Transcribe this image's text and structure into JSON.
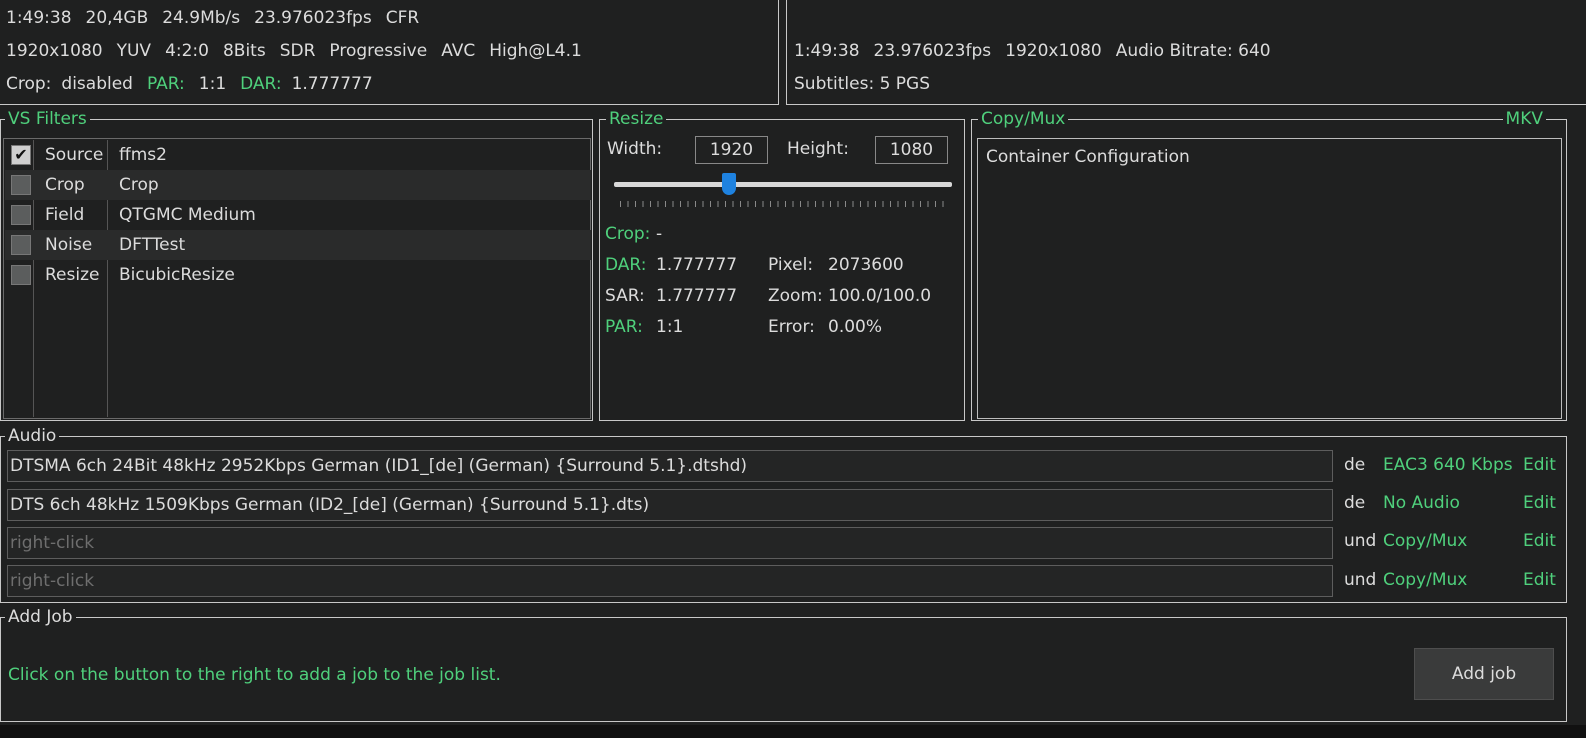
{
  "info_left": {
    "line1": [
      "1:49:38",
      "20,4GB",
      "24.9Mb/s",
      "23.976023fps",
      "CFR"
    ],
    "line2": [
      "1920x1080",
      "YUV",
      "4:2:0",
      "8Bits",
      "SDR",
      "Progressive",
      "AVC",
      "High@L4.1"
    ],
    "crop_label": "Crop:",
    "crop_value": "disabled",
    "par_label": "PAR:",
    "par_value": "1:1",
    "dar_label": "DAR:",
    "dar_value": "1.777777"
  },
  "info_right": {
    "line1": [
      "1:49:38",
      "23.976023fps",
      "1920x1080",
      "Audio Bitrate: 640"
    ],
    "line2": "Subtitles: 5 PGS"
  },
  "vs_filters": {
    "title": "VS Filters",
    "items": [
      {
        "checked": true,
        "name": "Source",
        "value": "ffms2"
      },
      {
        "checked": false,
        "name": "Crop",
        "value": "Crop"
      },
      {
        "checked": false,
        "name": "Field",
        "value": "QTGMC Medium"
      },
      {
        "checked": false,
        "name": "Noise",
        "value": "DFTTest"
      },
      {
        "checked": false,
        "name": "Resize",
        "value": "BicubicResize"
      }
    ],
    "check_glyph": "✔"
  },
  "resize": {
    "title": "Resize",
    "width_label": "Width:",
    "width_value": "1920",
    "height_label": "Height:",
    "height_value": "1080",
    "slider_fraction": 0.34,
    "crop_label": "Crop:",
    "crop_value": "-",
    "dar_label": "DAR:",
    "dar_value": "1.777777",
    "sar_label": "SAR:",
    "sar_value": "1.777777",
    "par_label": "PAR:",
    "par_value": "1:1",
    "pixel_label": "Pixel:",
    "pixel_value": "2073600",
    "zoom_label": "Zoom:",
    "zoom_value": "100.0/100.0",
    "error_label": "Error:",
    "error_value": "0.00%"
  },
  "container": {
    "title": "Copy/Mux",
    "format": "MKV",
    "text": "Container Configuration"
  },
  "audio": {
    "title": "Audio",
    "tracks": [
      {
        "file": "DTSMA 6ch 24Bit 48kHz 2952Kbps German (ID1_[de] (German) {Surround 5.1}.dtshd)",
        "placeholder": false,
        "lang": "de",
        "codec": "EAC3 640 Kbps",
        "edit": "Edit"
      },
      {
        "file": "DTS 6ch 48kHz 1509Kbps German (ID2_[de] (German) {Surround 5.1}.dts)",
        "placeholder": false,
        "lang": "de",
        "codec": "No Audio",
        "edit": "Edit"
      },
      {
        "file": "right-click",
        "placeholder": true,
        "lang": "und",
        "codec": "Copy/Mux",
        "edit": "Edit"
      },
      {
        "file": "right-click",
        "placeholder": true,
        "lang": "und",
        "codec": "Copy/Mux",
        "edit": "Edit"
      }
    ]
  },
  "add_job": {
    "title": "Add Job",
    "hint": "Click on the button to the right to add a job to the job list.",
    "button": "Add job"
  },
  "colors": {
    "accent_green": "#4fd07c",
    "background": "#1f2020",
    "slider_handle": "#1e82e0"
  }
}
